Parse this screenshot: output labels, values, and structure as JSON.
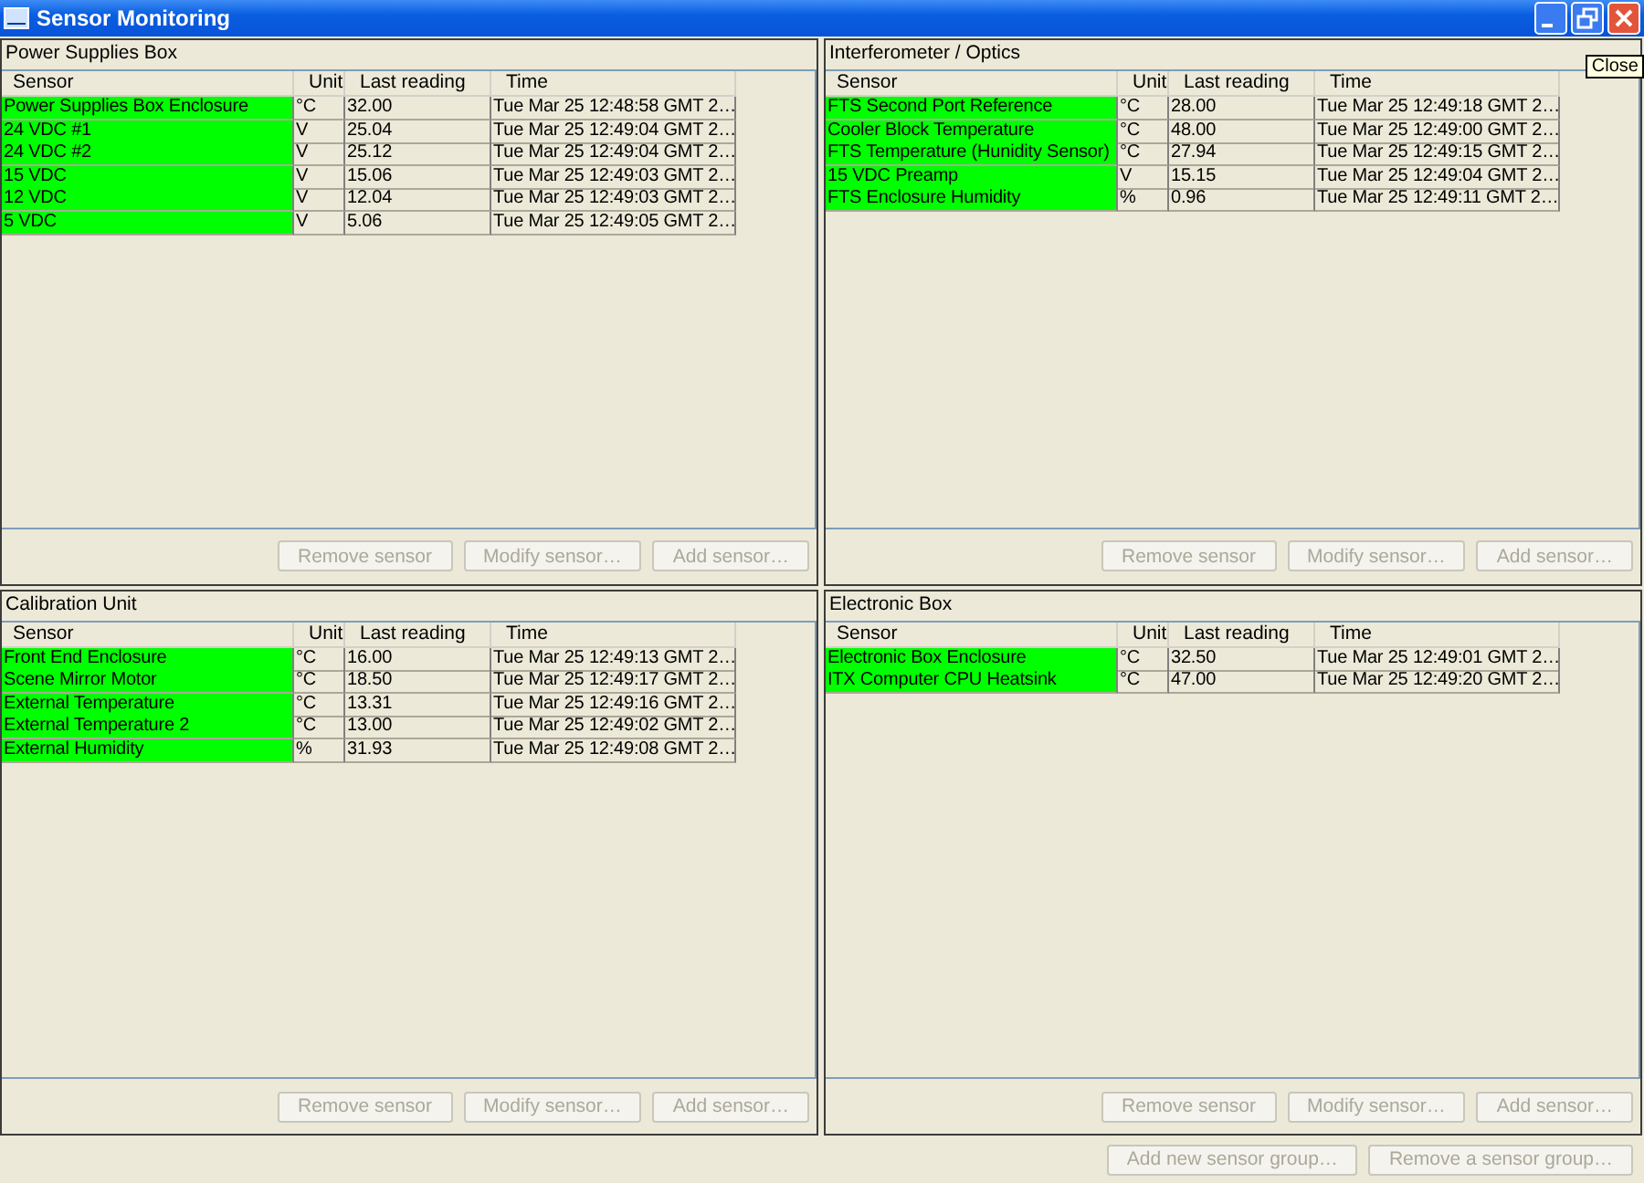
{
  "window": {
    "title": "Sensor Monitoring",
    "tooltip": "Close"
  },
  "groups": [
    {
      "title": "Power Supplies Box",
      "columns": [
        "Sensor",
        "Unit",
        "Last reading",
        "Time"
      ],
      "rows": [
        {
          "sensor": "Power Supplies Box Enclosure",
          "unit": "°C",
          "reading": "32.00",
          "time": "Tue Mar 25 12:48:58 GMT 2…",
          "color": "#00ff00"
        },
        {
          "sensor": "24 VDC #1",
          "unit": "V",
          "reading": "25.04",
          "time": "Tue Mar 25 12:49:04 GMT 2…",
          "color": "#00ff00"
        },
        {
          "sensor": "24 VDC #2",
          "unit": "V",
          "reading": "25.12",
          "time": "Tue Mar 25 12:49:04 GMT 2…",
          "color": "#00ff00"
        },
        {
          "sensor": "15 VDC",
          "unit": "V",
          "reading": "15.06",
          "time": "Tue Mar 25 12:49:03 GMT 2…",
          "color": "#00ff00"
        },
        {
          "sensor": "12 VDC",
          "unit": "V",
          "reading": "12.04",
          "time": "Tue Mar 25 12:49:03 GMT 2…",
          "color": "#00ff00"
        },
        {
          "sensor": "5 VDC",
          "unit": "V",
          "reading": "5.06",
          "time": "Tue Mar 25 12:49:05 GMT 2…",
          "color": "#00ff00"
        }
      ],
      "buttons": [
        {
          "label": "Remove sensor",
          "disabled": true
        },
        {
          "label": "Modify sensor…",
          "disabled": true
        },
        {
          "label": "Add sensor…",
          "disabled": true
        }
      ]
    },
    {
      "title": "Interferometer / Optics",
      "columns": [
        "Sensor",
        "Unit",
        "Last reading",
        "Time"
      ],
      "rows": [
        {
          "sensor": "FTS Second Port Reference",
          "unit": "°C",
          "reading": "28.00",
          "time": "Tue Mar 25 12:49:18 GMT 2…",
          "color": "#00ff00"
        },
        {
          "sensor": "Cooler Block Temperature",
          "unit": "°C",
          "reading": "48.00",
          "time": "Tue Mar 25 12:49:00 GMT 2…",
          "color": "#00ff00"
        },
        {
          "sensor": "FTS Temperature (Hunidity Sensor)",
          "unit": "°C",
          "reading": "27.94",
          "time": "Tue Mar 25 12:49:15 GMT 2…",
          "color": "#00ff00"
        },
        {
          "sensor": "15 VDC Preamp",
          "unit": "V",
          "reading": "15.15",
          "time": "Tue Mar 25 12:49:04 GMT 2…",
          "color": "#00ff00"
        },
        {
          "sensor": "FTS Enclosure Humidity",
          "unit": "%",
          "reading": "0.96",
          "time": "Tue Mar 25 12:49:11 GMT 2…",
          "color": "#00ff00"
        }
      ],
      "buttons": [
        {
          "label": "Remove sensor",
          "disabled": true
        },
        {
          "label": "Modify sensor…",
          "disabled": true
        },
        {
          "label": "Add sensor…",
          "disabled": true
        }
      ]
    },
    {
      "title": "Calibration Unit",
      "columns": [
        "Sensor",
        "Unit",
        "Last reading",
        "Time"
      ],
      "rows": [
        {
          "sensor": "Front End Enclosure",
          "unit": "°C",
          "reading": "16.00",
          "time": "Tue Mar 25 12:49:13 GMT 2…",
          "color": "#00ff00"
        },
        {
          "sensor": "Scene Mirror Motor",
          "unit": "°C",
          "reading": "18.50",
          "time": "Tue Mar 25 12:49:17 GMT 2…",
          "color": "#00ff00"
        },
        {
          "sensor": "External Temperature",
          "unit": "°C",
          "reading": "13.31",
          "time": "Tue Mar 25 12:49:16 GMT 2…",
          "color": "#00ff00"
        },
        {
          "sensor": "External Temperature 2",
          "unit": "°C",
          "reading": "13.00",
          "time": "Tue Mar 25 12:49:02 GMT 2…",
          "color": "#00ff00"
        },
        {
          "sensor": "External Humidity",
          "unit": "%",
          "reading": "31.93",
          "time": "Tue Mar 25 12:49:08 GMT 2…",
          "color": "#00ff00"
        }
      ],
      "buttons": [
        {
          "label": "Remove sensor",
          "disabled": true
        },
        {
          "label": "Modify sensor…",
          "disabled": true
        },
        {
          "label": "Add sensor…",
          "disabled": true
        }
      ]
    },
    {
      "title": "Electronic Box",
      "columns": [
        "Sensor",
        "Unit",
        "Last reading",
        "Time"
      ],
      "rows": [
        {
          "sensor": "Electronic Box Enclosure",
          "unit": "°C",
          "reading": "32.50",
          "time": "Tue Mar 25 12:49:01 GMT 2…",
          "color": "#00ff00"
        },
        {
          "sensor": "ITX Computer CPU Heatsink",
          "unit": "°C",
          "reading": "47.00",
          "time": "Tue Mar 25 12:49:20 GMT 2…",
          "color": "#00ff00"
        }
      ],
      "buttons": [
        {
          "label": "Remove sensor",
          "disabled": true
        },
        {
          "label": "Modify sensor…",
          "disabled": true
        },
        {
          "label": "Add sensor…",
          "disabled": true
        }
      ]
    }
  ],
  "footer_buttons": [
    {
      "label": "Add new sensor group…",
      "disabled": true
    },
    {
      "label": "Remove a sensor group…",
      "disabled": true
    }
  ]
}
